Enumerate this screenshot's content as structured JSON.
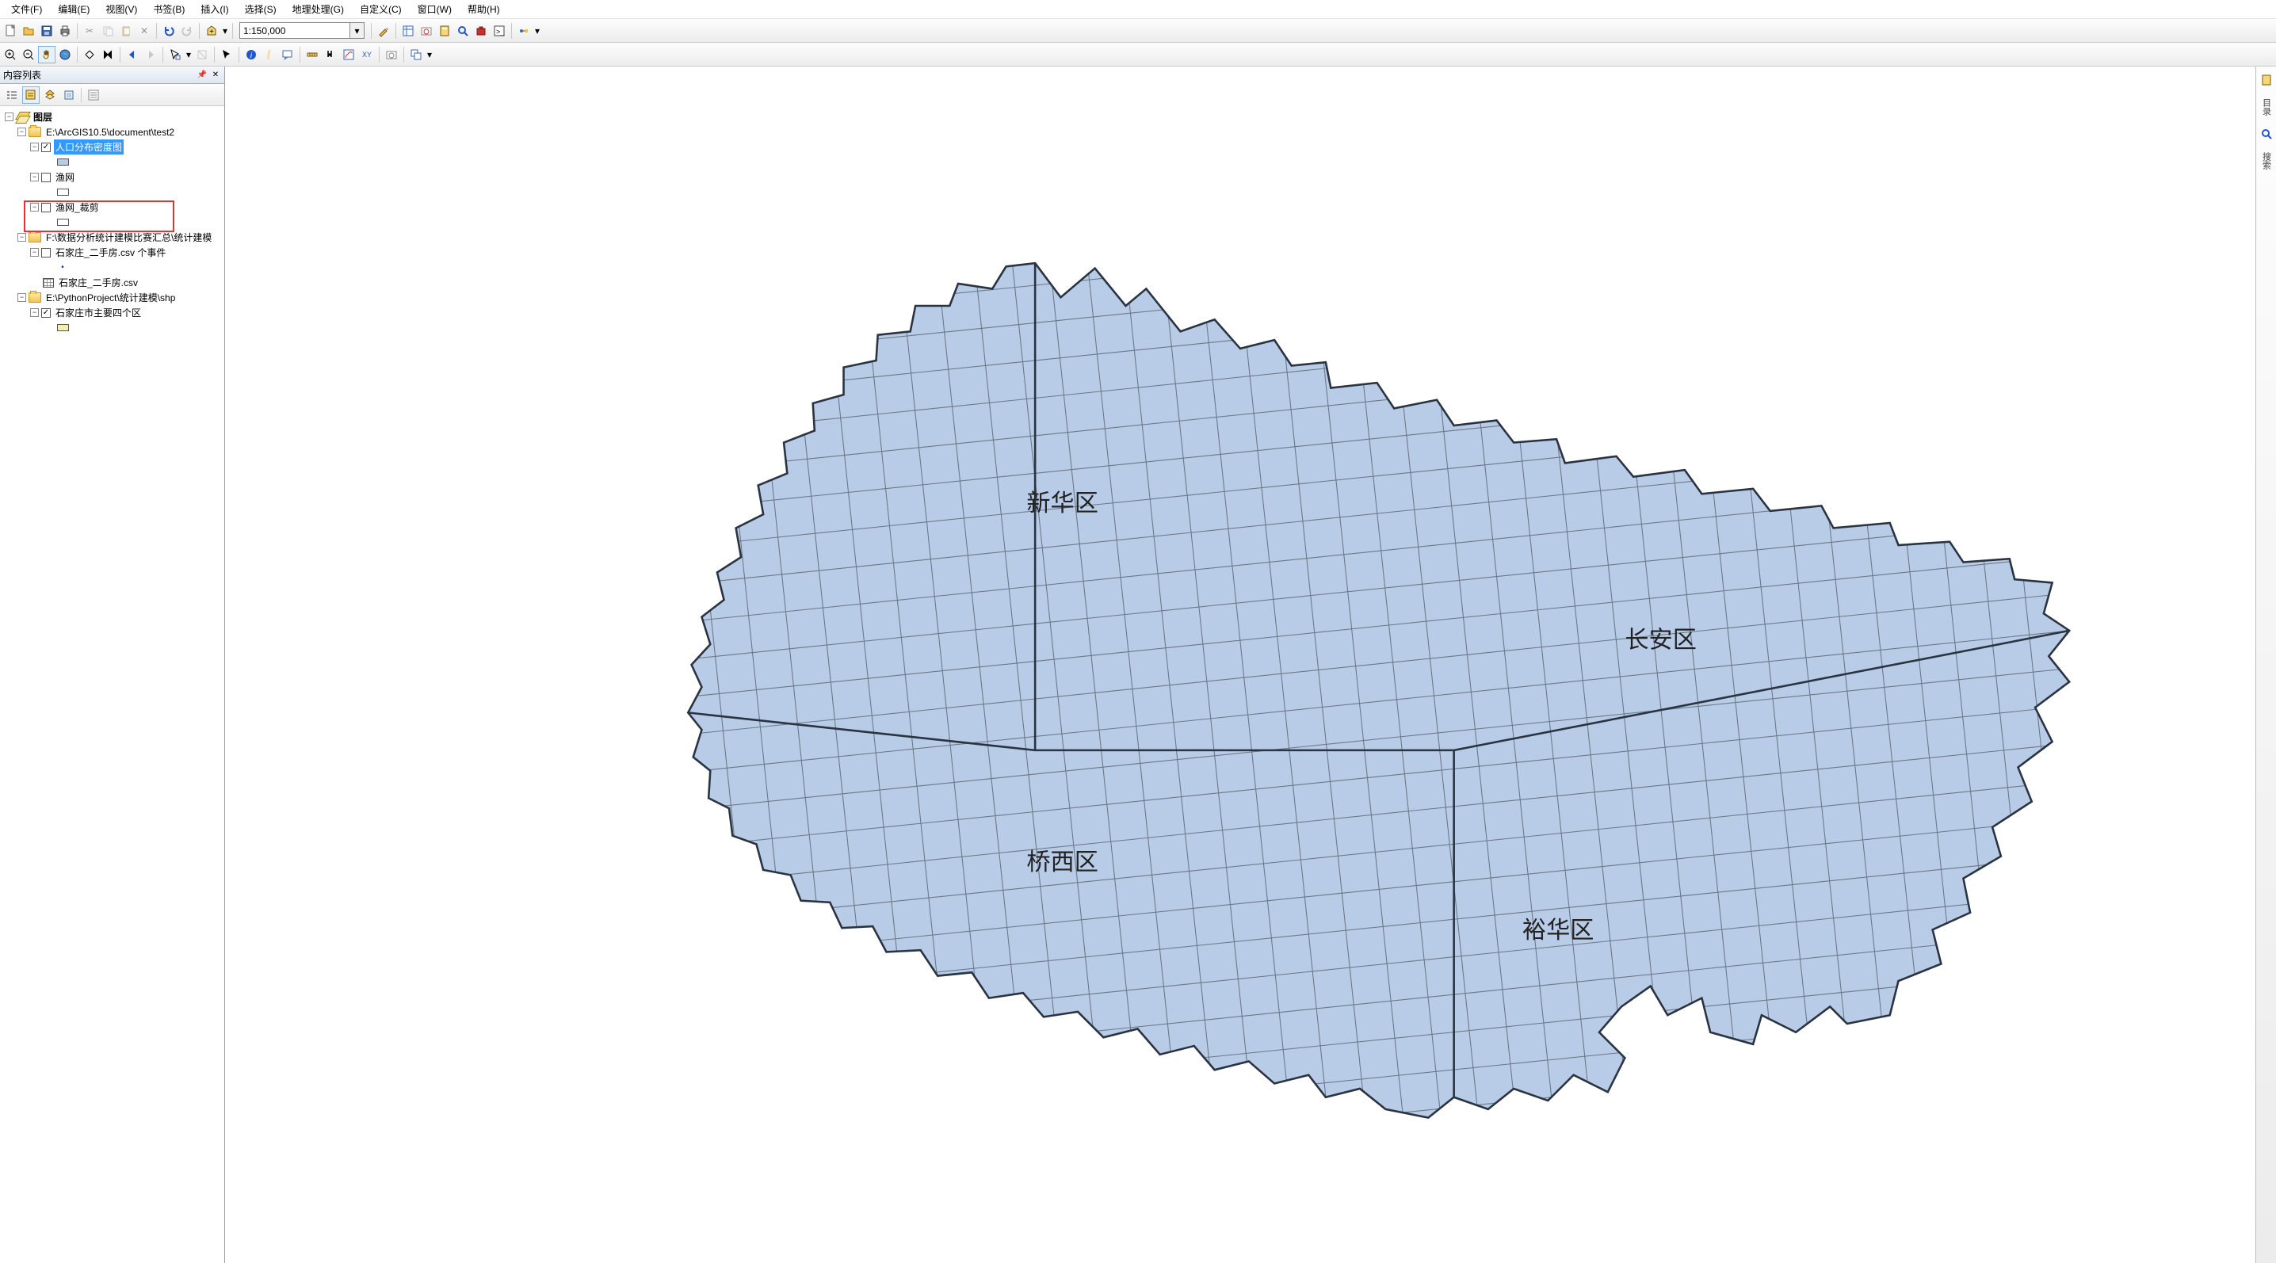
{
  "menu": {
    "file": "文件(F)",
    "edit": "编辑(E)",
    "view": "视图(V)",
    "bookmarks": "书签(B)",
    "insert": "插入(I)",
    "select": "选择(S)",
    "geoprocess": "地理处理(G)",
    "customize": "自定义(C)",
    "window": "窗口(W)",
    "help": "帮助(H)"
  },
  "scale": {
    "value": "1:150,000"
  },
  "toc": {
    "title": "内容列表",
    "root": "图层",
    "group1_path": "E:\\ArcGIS10.5\\document\\test2",
    "layer_popdensity": "人口分布密度图",
    "layer_fishnet": "渔网",
    "layer_fishnet_clip": "渔网_裁剪",
    "group2_path": "F:\\数据分析统计建模比赛汇总\\统计建模",
    "layer_csv_events": "石家庄_二手房.csv 个事件",
    "layer_csv": "石家庄_二手房.csv",
    "group3_path": "E:\\PythonProject\\统计建模\\shp",
    "layer_districts4": "石家庄市主要四个区"
  },
  "map_labels": {
    "xinhua": "新华区",
    "changan": "长安区",
    "qiaoxi": "桥西区",
    "yuhua": "裕华区"
  },
  "sidebar": {
    "catalog": "目录",
    "search": "搜索"
  }
}
